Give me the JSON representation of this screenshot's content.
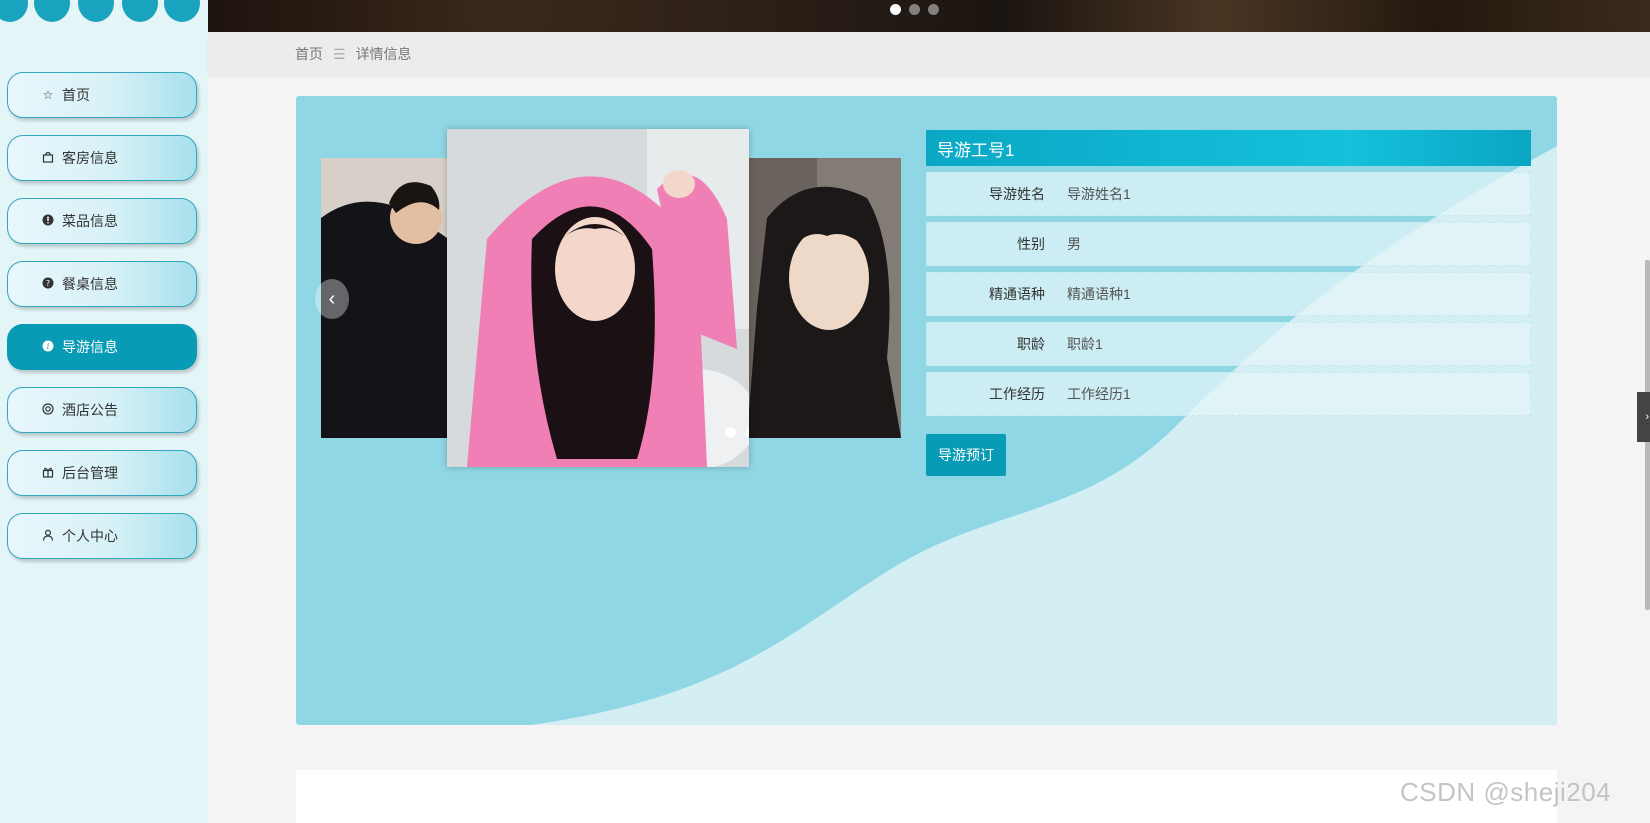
{
  "sidebar": {
    "items": [
      {
        "label": "首页",
        "icon": "star-icon",
        "active": false
      },
      {
        "label": "客房信息",
        "icon": "bag-icon",
        "active": false
      },
      {
        "label": "菜品信息",
        "icon": "exclamation-circle-icon",
        "active": false
      },
      {
        "label": "餐桌信息",
        "icon": "question-circle-icon",
        "active": false
      },
      {
        "label": "导游信息",
        "icon": "info-circle-icon",
        "active": true
      },
      {
        "label": "酒店公告",
        "icon": "lifebuoy-icon",
        "active": false
      },
      {
        "label": "后台管理",
        "icon": "gift-icon",
        "active": false
      },
      {
        "label": "个人中心",
        "icon": "user-icon",
        "active": false
      }
    ]
  },
  "breadcrumb": {
    "home": "首页",
    "separator": "☰",
    "current": "详情信息"
  },
  "detail": {
    "title": "导游工号1",
    "fields": [
      {
        "label": "导游姓名",
        "value": "导游姓名1"
      },
      {
        "label": "性别",
        "value": "男"
      },
      {
        "label": "精通语种",
        "value": "精通语种1"
      },
      {
        "label": "职龄",
        "value": "职龄1"
      },
      {
        "label": "工作经历",
        "value": "工作经历1"
      }
    ],
    "book_button": "导游预订"
  },
  "carousel": {
    "prev_icon": "‹",
    "slide_count": 3,
    "active_index": 0
  },
  "banner": {
    "dot_count": 3,
    "active_index": 0
  },
  "side_tab": {
    "icon": "›"
  },
  "watermark": "CSDN @sheji204",
  "colors": {
    "accent": "#089bb5",
    "panel": "#8fd7e4",
    "sidebar": "#e4f5f8"
  }
}
